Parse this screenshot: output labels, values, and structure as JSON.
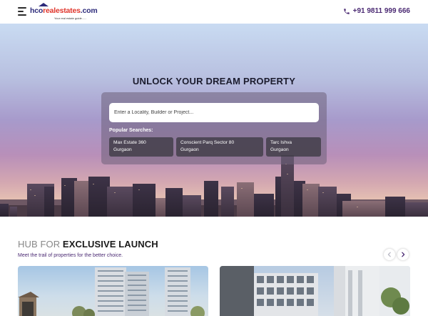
{
  "header": {
    "logo": {
      "brand_prefix": "hco",
      "brand_middle": "realestates",
      "brand_suffix": ".com",
      "tagline": "Your real estate guide......"
    },
    "phone": "+91 9811 999 666",
    "icons": {
      "menu": "hamburger-menu-icon",
      "phone": "phone-icon"
    }
  },
  "hero": {
    "title": "UNLOCK YOUR DREAM PROPERTY",
    "search": {
      "placeholder": "Enter a Locality, Builder or Project..."
    },
    "popular_label": "Popular Searches:",
    "popular_searches": [
      {
        "line1": "Max Estate 360",
        "line2": "Gurgaon"
      },
      {
        "line1": "Conscient Parq Sector 80",
        "line2": "Gurgaon"
      },
      {
        "line1": "Tarc Ishva",
        "line2": "Gurgaon"
      }
    ]
  },
  "section": {
    "title_light": "HUB FOR",
    "title_bold": "EXCLUSIVE LAUNCH",
    "subtitle": "Meet the trail of properties for the better choice.",
    "nav": {
      "prev_icon": "chevron-left-icon",
      "next_icon": "chevron-right-icon"
    }
  },
  "colors": {
    "brand_purple": "#4b2a73",
    "brand_red": "#e0362c",
    "brand_navy": "#2c2a7a"
  }
}
